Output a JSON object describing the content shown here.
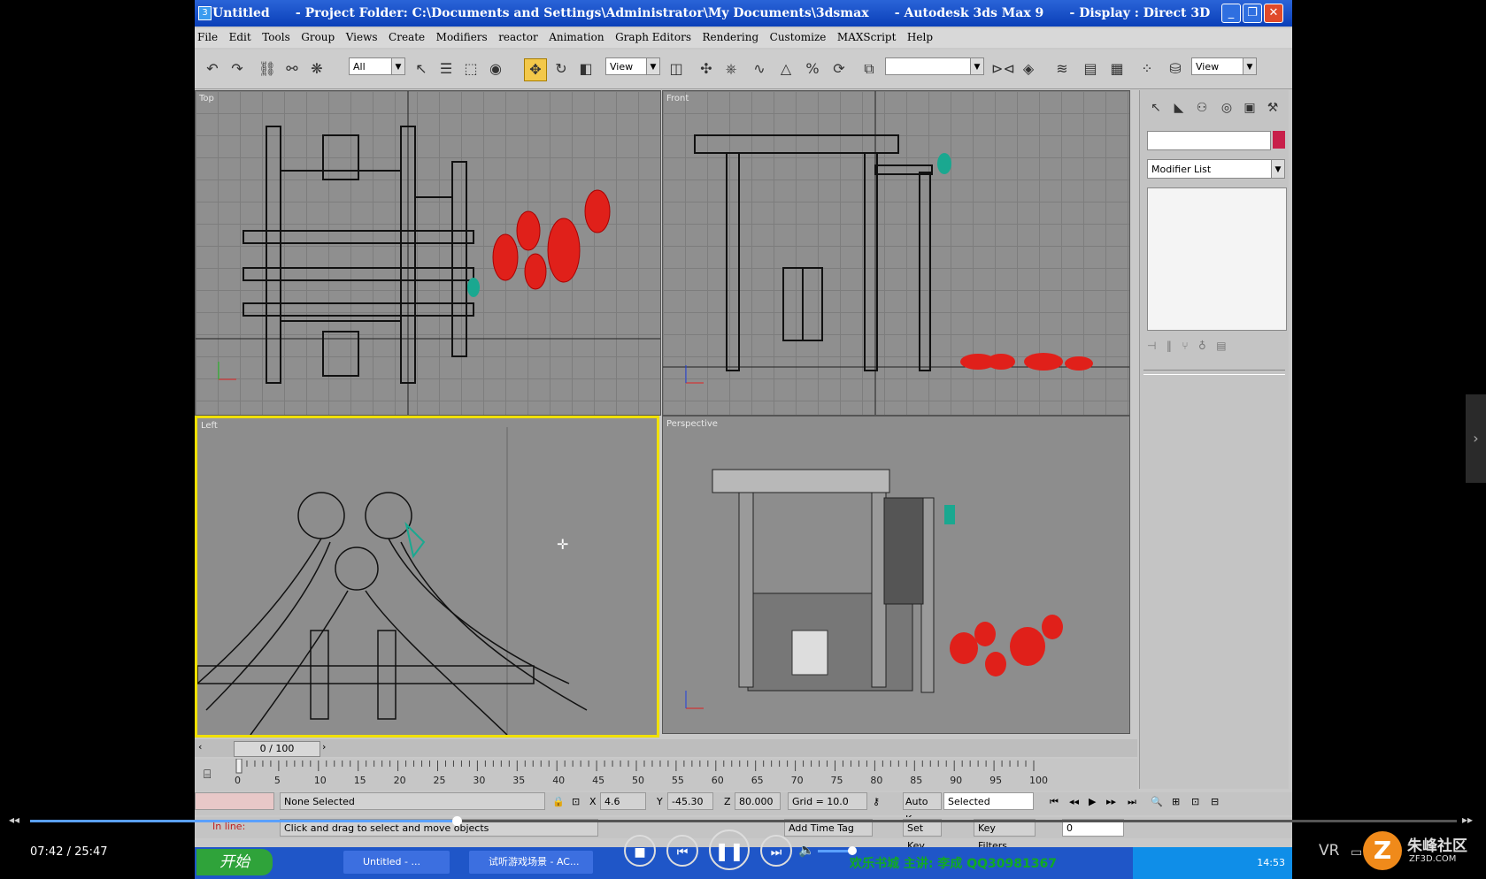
{
  "window": {
    "title": "Untitled      - Project Folder: C:\\Documents and Settings\\Administrator\\My Documents\\3dsmax      - Autodesk 3ds Max 9      - Display : Direct 3D",
    "min": "_",
    "restore": "❐",
    "close": "✕"
  },
  "menu": [
    "File",
    "Edit",
    "Tools",
    "Group",
    "Views",
    "Create",
    "Modifiers",
    "reactor",
    "Animation",
    "Graph Editors",
    "Rendering",
    "Customize",
    "MAXScript",
    "Help"
  ],
  "toolbar": {
    "selection_filter": "All",
    "ref_coord": "View",
    "named_sel": "",
    "render_type": "View"
  },
  "viewports": {
    "top": "Top",
    "front": "Front",
    "left": "Left",
    "perspective": "Perspective"
  },
  "command_panel": {
    "modifier_list": "Modifier List"
  },
  "timeline": {
    "frame_display": "0 / 100",
    "ticks": [
      "0",
      "5",
      "10",
      "15",
      "20",
      "25",
      "30",
      "35",
      "40",
      "45",
      "50",
      "55",
      "60",
      "65",
      "70",
      "75",
      "80",
      "85",
      "90",
      "95",
      "100"
    ]
  },
  "status": {
    "selection": "None Selected",
    "x_label": "X",
    "x_value": "4.6",
    "y_label": "Y",
    "y_value": "-45.30",
    "z_label": "Z",
    "z_value": "80.000",
    "grid": "Grid = 10.0",
    "auto_key": "Auto Key",
    "key_filter": "Selected",
    "prompt_label": "In line:",
    "prompt": "Click and drag to select and move objects",
    "add_time_tag": "Add Time Tag",
    "set_key": "Set Key",
    "key_filters": "Key Filters...",
    "frame": "0"
  },
  "taskbar": {
    "start": "开始",
    "items": [
      "Untitled - ...",
      "试听游戏场景 - AC..."
    ],
    "marquee": "欢乐书城 主讲: 李成 QQ30981367",
    "clock": "14:53"
  },
  "player": {
    "timecode": "07:42 / 25:47",
    "progress": 0.299,
    "volume": 0.85,
    "vr": "VR",
    "watermark": "朱峰社区",
    "watermark_url": "ZF3D.COM",
    "prev": "◂◂",
    "next": "▸▸"
  },
  "colors": {
    "titlebar": "#1e59d0",
    "active_viewport": "#f0e000",
    "lanterns": "#e0201a",
    "cyan_object": "#1aa890"
  }
}
